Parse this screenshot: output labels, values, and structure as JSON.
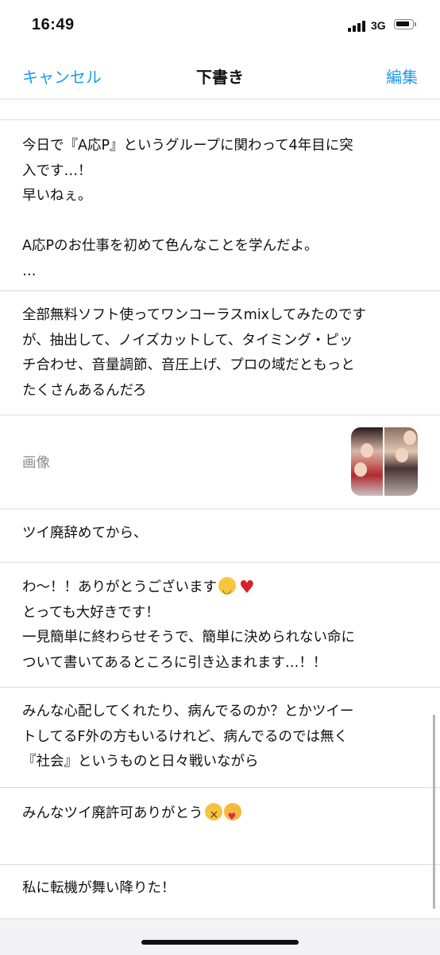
{
  "status": {
    "time": "16:49",
    "network": "3G"
  },
  "nav": {
    "cancel": "キャンセル",
    "title": "下書き",
    "edit": "編集"
  },
  "drafts": [
    {
      "text": "今日で『A応P』というグループに関わって4年目に突\n入です…！\n早いねぇ。\n\nA応Pのお仕事を初めて色んなことを学んだよ。\n…"
    },
    {
      "text": "全部無料ソフト使ってワンコーラスmixしてみたのです\nが、抽出して、ノイズカットして、タイミング・ピッ\nチ合わせ、音量調節、音圧上げ、プロの域だともっと\nたくさんあるんだろ"
    },
    {
      "label": "画像"
    },
    {
      "text": "ツイ廃辞めてから、"
    },
    {
      "text": "わ〜！！ありがとうございます",
      "text2": "とっても大好きです！\n一見簡単に終わらせそうで、簡単に決められない命に\nついて書いてあるところに引き込まれます…！！"
    },
    {
      "text": "みんな心配してくれたり、病んでるのか？とかツイー\nトしてるF外の方もいるけれど、病んでるのでは無く\n『社会』というものと日々戦いながら"
    },
    {
      "text": "みんなツイ廃許可ありがとう"
    },
    {
      "text": "私に転機が舞い降りた！"
    }
  ],
  "icons": [
    "signal-icon",
    "battery-icon",
    "smile-emoji-icon",
    "red-heart-icon",
    "crying-emoji-icon",
    "love-emoji-icon"
  ],
  "colors": {
    "accent": "#1d9bf0",
    "secondary_text": "#8a8a8e",
    "separator": "#dcdcdc"
  }
}
